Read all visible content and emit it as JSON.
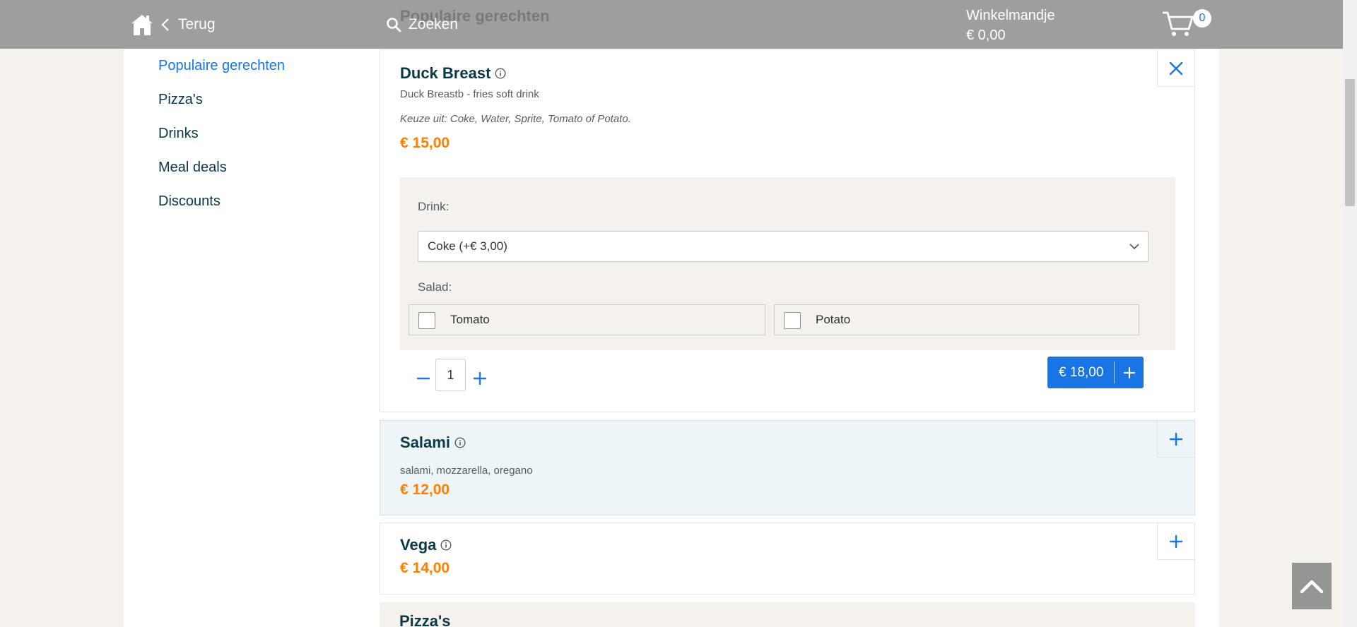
{
  "header": {
    "back_label": "Terug",
    "search_label": "Zoeken",
    "ghost_title": "Populaire gerechten",
    "cart_title": "Winkelmandje",
    "cart_total": "€ 0,00",
    "cart_count": "0"
  },
  "sidebar": {
    "items": [
      {
        "label": "Populaire gerechten",
        "active": true
      },
      {
        "label": "Pizza's"
      },
      {
        "label": "Drinks"
      },
      {
        "label": "Meal deals"
      },
      {
        "label": "Discounts"
      }
    ]
  },
  "expanded_dish": {
    "name": "Duck Breast",
    "description": "Duck Breastb - fries soft drink",
    "choice_note": "Keuze uit: Coke, Water, Sprite, Tomato of Potato.",
    "price": "€ 15,00",
    "drink_label": "Drink:",
    "drink_selected": "Coke (+€ 3,00)",
    "salad_label": "Salad:",
    "salad_options": [
      "Tomato",
      "Potato"
    ],
    "quantity": "1",
    "add_total": "€ 18,00"
  },
  "dishes": [
    {
      "name": "Salami",
      "description": "salami, mozzarella, oregano",
      "price": "€ 12,00"
    },
    {
      "name": "Vega",
      "price": "€ 14,00"
    }
  ],
  "next_category": "Pizza's",
  "colors": {
    "accent": "#1875e3",
    "price": "#ff8000",
    "header_bg": "#9e9e9e",
    "text_dark": "#0a3847",
    "highlight_bg": "#edf5f8"
  }
}
